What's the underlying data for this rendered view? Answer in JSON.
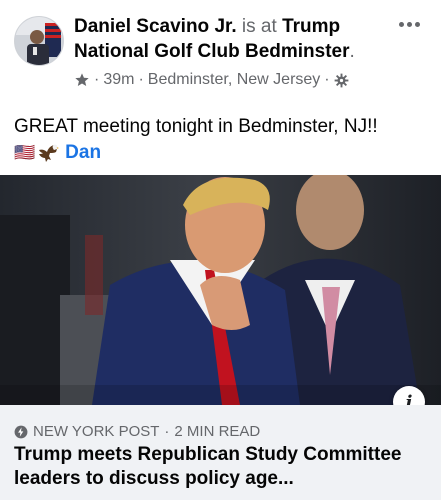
{
  "post": {
    "author": "Daniel Scavino Jr.",
    "is_at": "is at",
    "location_name": "Trump National Golf Club Bedminster",
    "location_dot": ".",
    "time": "39m",
    "place": "Bedminster, New Jersey",
    "separator": "·",
    "text": "GREAT meeting tonight in Bedminster, NJ!!",
    "signature_flag": "🇺🇸",
    "signature_name": "Dan"
  },
  "link": {
    "source": "NEW YORK POST",
    "read_time": "2 MIN READ",
    "title": "Trump meets Republican Study Committee leaders to discuss policy age..."
  },
  "icons": {
    "more": "more-options-icon",
    "star": "favorite-star-icon",
    "privacy": "privacy-gear-icon",
    "eagle": "eagle-icon",
    "source": "lightning-icon",
    "info": "info-icon"
  },
  "colors": {
    "link_blue": "#1b74e4",
    "secondary_text": "#65676b",
    "card_background": "#f0f2f5"
  }
}
